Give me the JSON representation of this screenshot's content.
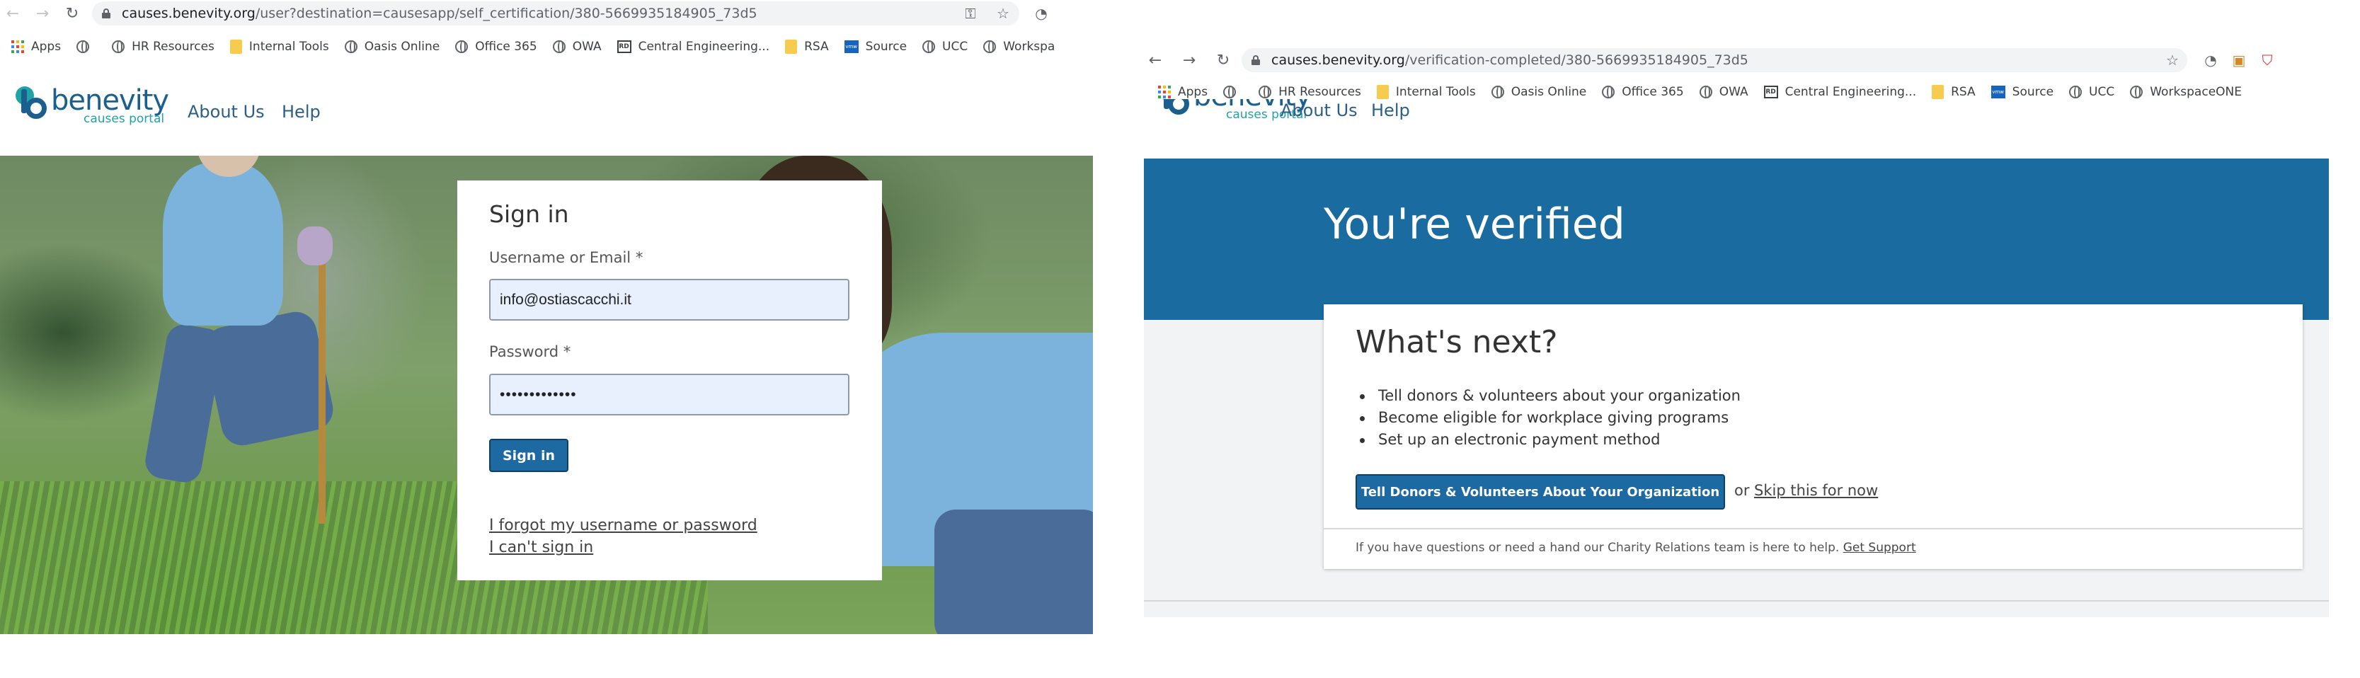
{
  "left": {
    "browser": {
      "url_host": "causes.benevity.org",
      "url_path": "/user?destination=causesapp/self_certification/380-5669935184905_73d5",
      "icons": [
        "back-icon",
        "forward-icon",
        "reload-icon",
        "lock-icon",
        "key-icon",
        "star-icon",
        "extension-icon"
      ]
    },
    "bookmarks": [
      "Apps",
      "",
      "HR Resources",
      "Internal Tools",
      "Oasis Online",
      "Office 365",
      "OWA",
      "Central Engineering...",
      "RSA",
      "Source",
      "UCC",
      "Workspa"
    ],
    "header": {
      "logo_word": "benevity",
      "logo_sub": "causes portal",
      "nav": [
        "About Us",
        "Help"
      ]
    },
    "signin": {
      "title": "Sign in",
      "username_label": "Username or Email *",
      "username_value": "info@ostiascacchi.it",
      "password_label": "Password *",
      "password_value": "•••••••••••••",
      "submit_label": "Sign in",
      "forgot_link": "I forgot my username or password",
      "cant_signin_link": "I can't sign in"
    }
  },
  "right": {
    "browser": {
      "url_host": "causes.benevity.org",
      "url_path": "/verification-completed/380-5669935184905_73d5",
      "icons": [
        "back-icon",
        "forward-icon",
        "reload-icon",
        "lock-icon",
        "star-icon",
        "extension-icon"
      ]
    },
    "bookmarks": [
      "Apps",
      "",
      "HR Resources",
      "Internal Tools",
      "Oasis Online",
      "Office 365",
      "OWA",
      "Central Engineering...",
      "RSA",
      "Source",
      "UCC",
      "WorkspaceONE"
    ],
    "header": {
      "logo_word": "benevity",
      "logo_sub": "causes portal",
      "nav": [
        "About Us",
        "Help"
      ]
    },
    "banner_title": "You're verified",
    "card": {
      "title": "What's next?",
      "items": [
        "Tell donors & volunteers about your organization",
        "Become eligible for workplace giving programs",
        "Set up an electronic payment method"
      ],
      "primary_button": "Tell Donors & Volunteers About Your Organization",
      "or_text": "or",
      "skip_link": "Skip this for now",
      "footnote": "If you have questions or need a hand our Charity Relations team is here to help.",
      "support_link": "Get Support"
    }
  },
  "colors": {
    "brand_blue": "#1a6b9f",
    "button_blue": "#1c6aa1",
    "logo_teal": "#1fa3a6",
    "autofill_bg": "#e8f0fe"
  }
}
